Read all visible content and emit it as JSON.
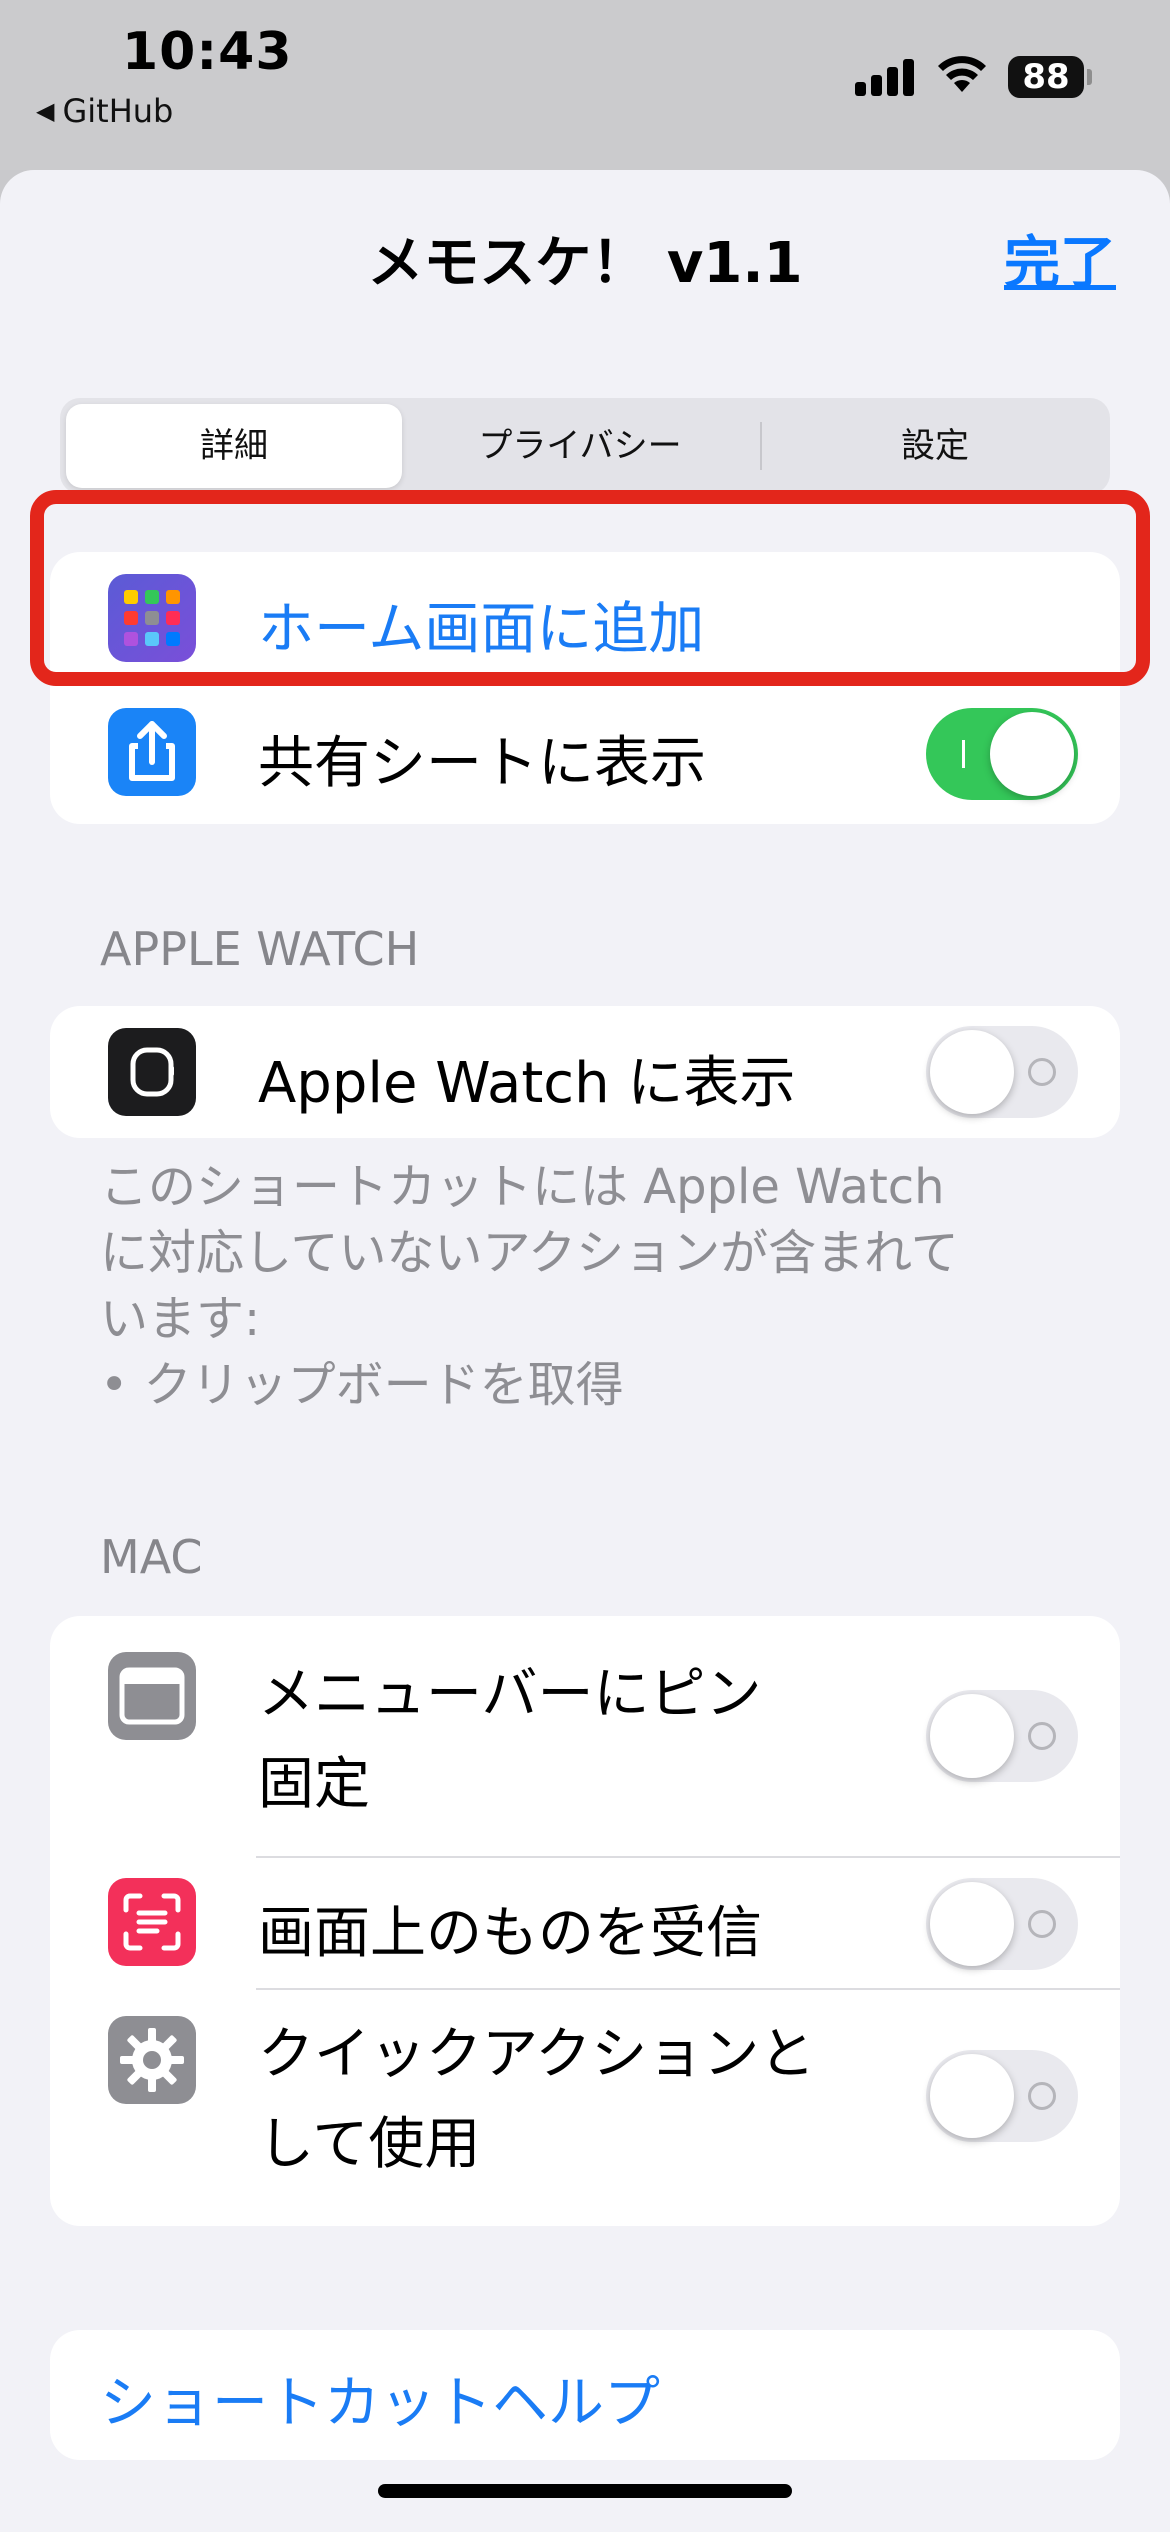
{
  "status": {
    "time": "10:43",
    "back_label": "GitHub",
    "battery": "88"
  },
  "sheet": {
    "title": "メモスケ！ v1.1",
    "done_label": "完了"
  },
  "tabs": [
    {
      "label": "詳細",
      "active": true
    },
    {
      "label": "プライバシー",
      "active": false
    },
    {
      "label": "設定",
      "active": false
    }
  ],
  "actions": {
    "add_home_label": "ホーム画面に追加",
    "share_sheet_label": "共有シートに表示",
    "share_sheet_on": true
  },
  "apple_watch": {
    "header": "APPLE WATCH",
    "show_label": "Apple Watch に表示",
    "show_on": false,
    "footnote_lines": [
      "このショートカットには Apple Watch",
      "に対応していないアクションが含まれて",
      "います:",
      "• クリップボードを取得"
    ]
  },
  "mac": {
    "header": "MAC",
    "items": [
      {
        "label_lines": [
          "メニューバーにピン",
          "固定"
        ],
        "on": false
      },
      {
        "label_lines": [
          "画面上のものを受信"
        ],
        "on": false
      },
      {
        "label_lines": [
          "クイックアクションと",
          "して使用"
        ],
        "on": false
      }
    ]
  },
  "help_label": "ショートカットヘルプ",
  "colors": {
    "accent": "#0a78ff",
    "toggle_on": "#34c759",
    "highlight": "#e3261b"
  }
}
